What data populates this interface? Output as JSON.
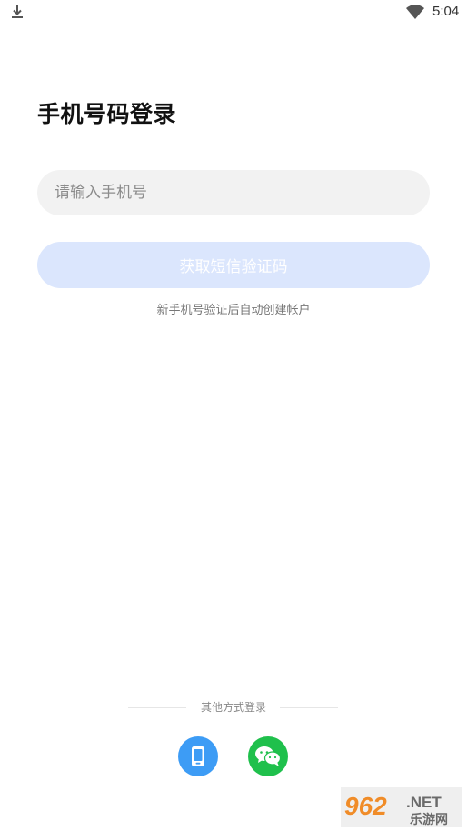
{
  "status_bar": {
    "time": "5:04",
    "left_icon": "download-icon",
    "wifi_icon": "wifi-icon"
  },
  "login": {
    "title": "手机号码登录",
    "phone_placeholder": "请输入手机号",
    "phone_value": "",
    "get_code_label": "获取短信验证码",
    "hint": "新手机号验证后自动创建帐户"
  },
  "other_methods": {
    "label": "其他方式登录",
    "options": [
      {
        "icon": "phone-icon",
        "color": "#3d9cf5"
      },
      {
        "icon": "wechat-icon",
        "color": "#1fc04c"
      }
    ]
  },
  "watermark": {
    "brand": "962",
    "suffix": ".NET",
    "cn_text": "乐游网"
  },
  "colors": {
    "button_disabled_bg": "#dbe6fd",
    "input_bg": "#f2f2f2",
    "phone_blue": "#3d9cf5",
    "wechat_green": "#1fc04c"
  }
}
